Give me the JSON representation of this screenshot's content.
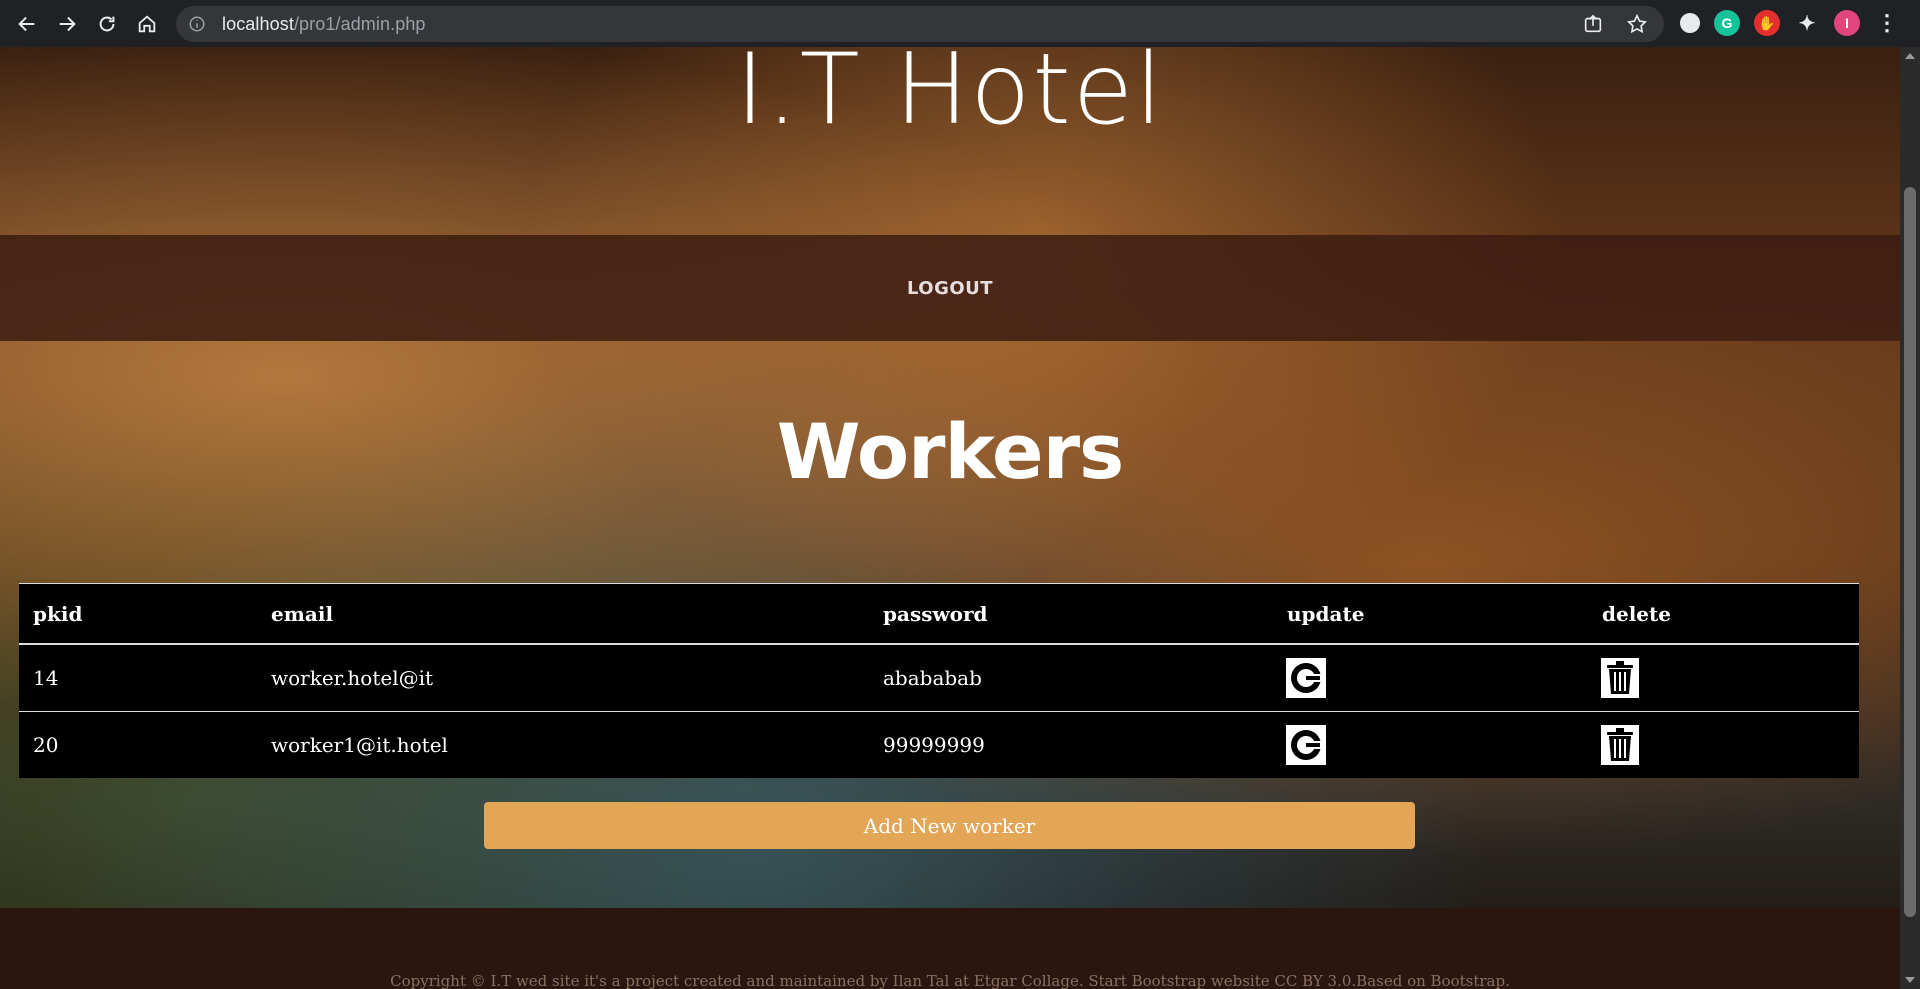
{
  "browser": {
    "url_host": "localhost",
    "url_path": "/pro1/admin.php"
  },
  "site": {
    "title": "I.T Hotel",
    "logout_label": "LOGOUT"
  },
  "main": {
    "heading": "Workers",
    "table": {
      "headers": [
        "pkid",
        "email",
        "password",
        "update",
        "delete"
      ],
      "rows": [
        {
          "pkid": "14",
          "email": "worker.hotel@it",
          "password": "abababab"
        },
        {
          "pkid": "20",
          "email": "worker1@it.hotel",
          "password": "99999999"
        }
      ]
    },
    "add_button_label": "Add New worker"
  },
  "footer": {
    "copyright": "Copyright © I.T wed site it's a project created and maintained by Ilan Tal at Etgar Collage. Start Bootstrap website CC BY 3.0.Based on Bootstrap."
  },
  "colors": {
    "accent": "#e3a556",
    "chrome_bg": "#202124"
  }
}
